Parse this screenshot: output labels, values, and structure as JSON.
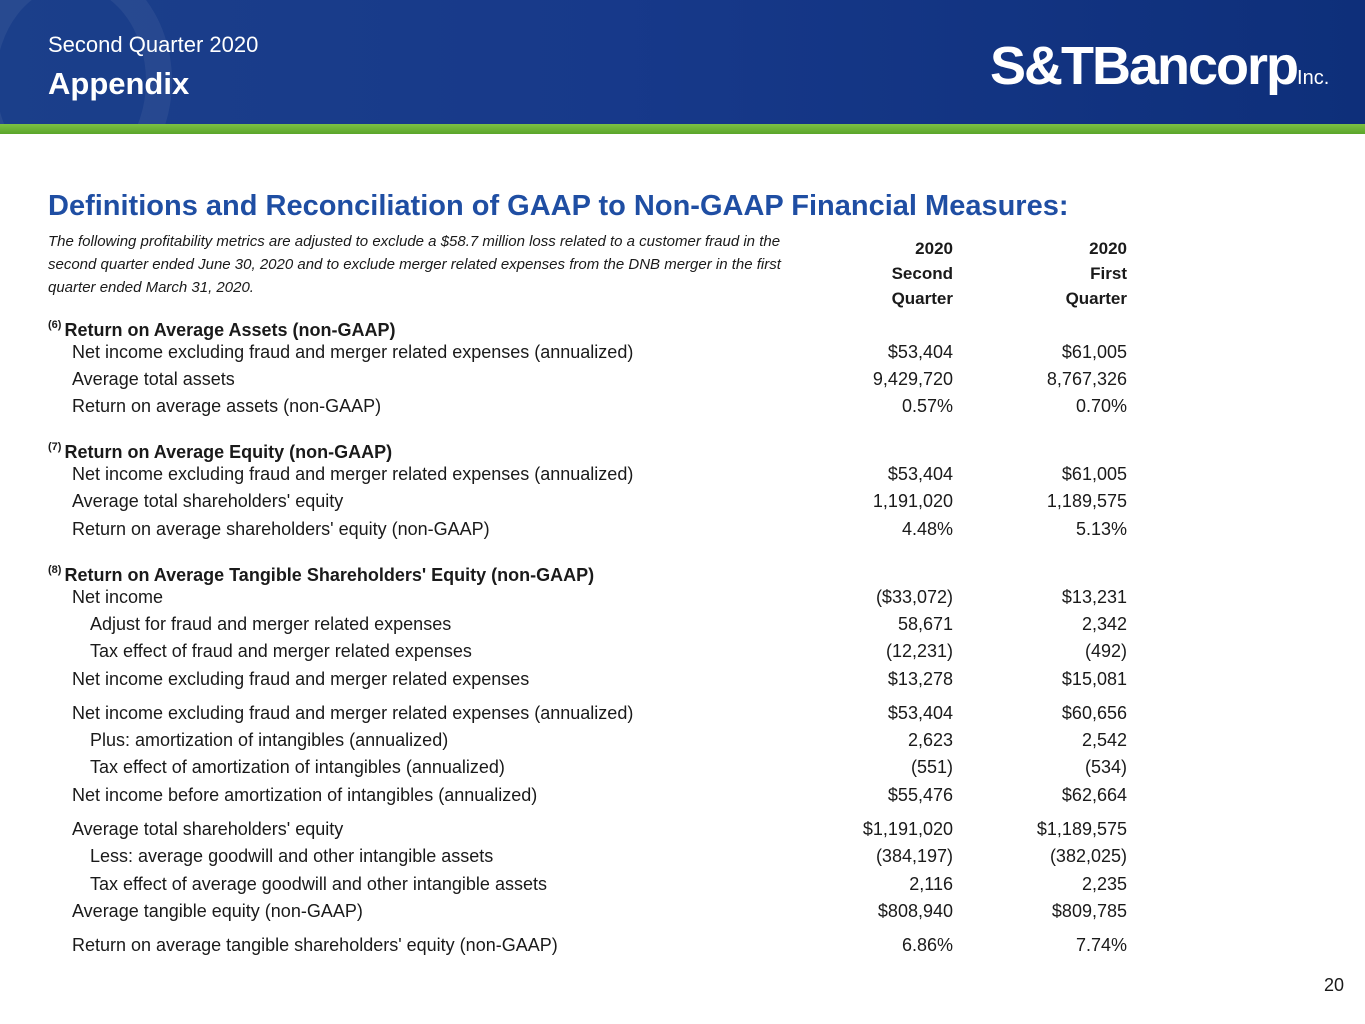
{
  "header": {
    "subtitle": "Second Quarter 2020",
    "title": "Appendix",
    "logo": {
      "main": "S&TBancorp",
      "suffix": "Inc."
    }
  },
  "colors": {
    "header_blue": "#17398a",
    "accent_green": "#6ab536",
    "heading_blue": "#1f4ea3"
  },
  "content": {
    "heading": "Definitions and Reconciliation of GAAP to Non-GAAP Financial Measures:",
    "note": "The following profitability metrics are adjusted to exclude a $58.7 million loss related to a customer fraud in the second quarter ended June 30, 2020 and to exclude merger related expenses from the DNB merger in the first quarter ended March 31, 2020.",
    "columns": [
      {
        "year": "2020",
        "line1": "Second",
        "line2": "Quarter"
      },
      {
        "year": "2020",
        "line1": "First",
        "line2": "Quarter"
      }
    ],
    "sections": [
      {
        "ref": "(6)",
        "title": "Return on Average Assets (non-GAAP)",
        "rows": [
          {
            "label": "Net income excluding fraud and merger related expenses (annualized)",
            "q2": "$53,404",
            "q1": "$61,005"
          },
          {
            "label": "Average total assets",
            "q2": "9,429,720",
            "q1": "8,767,326"
          },
          {
            "label": "Return on average assets (non-GAAP)",
            "q2": "0.57%",
            "q1": "0.70%"
          }
        ]
      },
      {
        "ref": "(7)",
        "title": "Return on Average Equity (non-GAAP)",
        "rows": [
          {
            "label": "Net income excluding fraud and merger related expenses (annualized)",
            "q2": "$53,404",
            "q1": "$61,005"
          },
          {
            "label": "Average total shareholders' equity",
            "q2": "1,191,020",
            "q1": "1,189,575"
          },
          {
            "label": "Return on average shareholders' equity (non-GAAP)",
            "q2": "4.48%",
            "q1": "5.13%"
          }
        ]
      },
      {
        "ref": "(8)",
        "title": "Return on Average Tangible Shareholders' Equity (non-GAAP)",
        "rows": [
          {
            "label": "Net income",
            "q2": "($33,072)",
            "q1": "$13,231"
          },
          {
            "label": "Adjust for fraud and merger related expenses",
            "q2": "58,671",
            "q1": "2,342"
          },
          {
            "label": "Tax effect of fraud and merger related expenses",
            "q2": "(12,231)",
            "q1": "(492)"
          },
          {
            "label": "Net income excluding fraud and merger related expenses",
            "q2": "$13,278",
            "q1": "$15,081"
          },
          {
            "label": "Net income excluding fraud and merger related expenses (annualized)",
            "q2": "$53,404",
            "q1": "$60,656"
          },
          {
            "label": "Plus: amortization of intangibles (annualized)",
            "q2": "2,623",
            "q1": "2,542"
          },
          {
            "label": "Tax effect of amortization of intangibles (annualized)",
            "q2": "(551)",
            "q1": "(534)"
          },
          {
            "label": "Net income before amortization of intangibles (annualized)",
            "q2": "$55,476",
            "q1": "$62,664"
          },
          {
            "label": "Average total shareholders' equity",
            "q2": "$1,191,020",
            "q1": "$1,189,575"
          },
          {
            "label": "Less: average goodwill and other intangible assets",
            "q2": "(384,197)",
            "q1": "(382,025)"
          },
          {
            "label": "Tax effect of average goodwill and other intangible assets",
            "q2": "2,116",
            "q1": "2,235"
          },
          {
            "label": "Average tangible equity (non-GAAP)",
            "q2": "$808,940",
            "q1": "$809,785"
          },
          {
            "label": "Return on average tangible shareholders' equity (non-GAAP)",
            "q2": "6.86%",
            "q1": "7.74%"
          }
        ]
      }
    ]
  },
  "footer": {
    "page_number": "20"
  }
}
